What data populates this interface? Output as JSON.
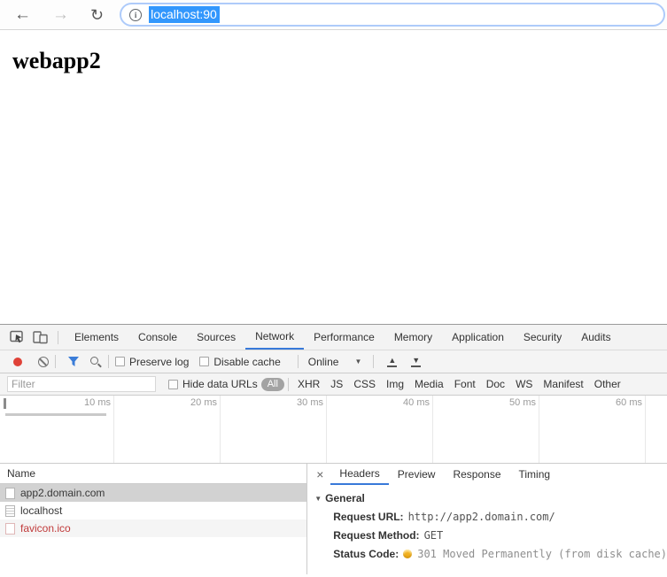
{
  "browser": {
    "url_selected": "localhost:90",
    "icons": {
      "back": "←",
      "forward": "→",
      "reload": "↻",
      "info": "i"
    }
  },
  "page": {
    "title": "webapp2"
  },
  "devtools": {
    "tabs": [
      "Elements",
      "Console",
      "Sources",
      "Network",
      "Performance",
      "Memory",
      "Application",
      "Security",
      "Audits"
    ],
    "active_tab": "Network",
    "toolbar": {
      "preserve_log": "Preserve log",
      "disable_cache": "Disable cache",
      "throttling": "Online",
      "icons": {
        "dropdown": "▼",
        "import": "▲",
        "export": "▼"
      }
    },
    "filter": {
      "placeholder": "Filter",
      "hide_data_urls": "Hide data URLs",
      "types": [
        "All",
        "XHR",
        "JS",
        "CSS",
        "Img",
        "Media",
        "Font",
        "Doc",
        "WS",
        "Manifest",
        "Other"
      ],
      "active_type": "All"
    },
    "overview": {
      "ticks": [
        "10 ms",
        "20 ms",
        "30 ms",
        "40 ms",
        "50 ms",
        "60 ms"
      ]
    },
    "requests": {
      "header": "Name",
      "rows": [
        {
          "name": "app2.domain.com",
          "state": "selected"
        },
        {
          "name": "localhost",
          "state": "normal"
        },
        {
          "name": "favicon.ico",
          "state": "error"
        }
      ]
    },
    "details": {
      "close": "×",
      "tabs": [
        "Headers",
        "Preview",
        "Response",
        "Timing"
      ],
      "active_tab": "Headers",
      "disclosure": "▼",
      "section_title": "General",
      "fields": [
        {
          "label": "Request URL:",
          "value": "http://app2.domain.com/"
        },
        {
          "label": "Request Method:",
          "value": "GET"
        },
        {
          "label": "Status Code:",
          "value": "301 Moved Permanently (from disk cache)"
        }
      ],
      "status_dot_color": "#f2b01e"
    }
  },
  "colors": {
    "selection_blue": "#3297fd",
    "accent_blue": "#3879d9",
    "record_red": "#df4238",
    "funnel_blue": "#3b7dd8",
    "error_red": "#c13b3b",
    "status_yellow": "#f2b01e",
    "toolbar_gray": "#f4f4f4",
    "selected_row_gray": "#d2d2d2"
  }
}
